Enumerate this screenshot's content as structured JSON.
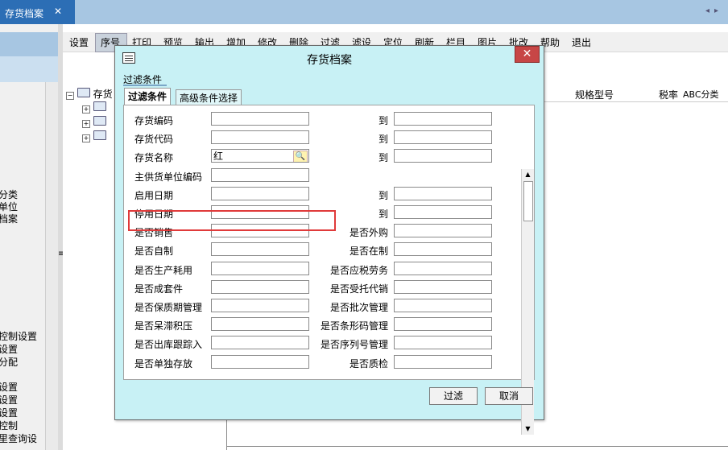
{
  "tab": {
    "title": "存货档案",
    "close": "✕",
    "nav": "◂▸"
  },
  "toolbar": [
    "设置",
    "序号",
    "打印",
    "预览",
    "输出",
    "增加",
    "修改",
    "删除",
    "过滤",
    "滤设",
    "定位",
    "刷新",
    "栏目",
    "图片",
    "批改",
    "帮助",
    "退出"
  ],
  "left_items": [
    "分类",
    "单位",
    "档案",
    "控制设置",
    "设置",
    "分配",
    "设置",
    "设置",
    "设置",
    "控制",
    "里查询设"
  ],
  "tree": {
    "root_label": "存货",
    "nodes": 3
  },
  "grid_headers": [
    "规格型号",
    "税率",
    "ABC分类"
  ],
  "dialog": {
    "title": "存货档案",
    "close_label": "✕",
    "group_label": "过滤条件",
    "tabs": [
      "过滤条件",
      "高级条件选择"
    ],
    "to_label": "到",
    "rows": [
      {
        "left": "存货编码",
        "right": "到",
        "value": ""
      },
      {
        "left": "存货代码",
        "right": "到",
        "value": ""
      },
      {
        "left": "存货名称",
        "right": "到",
        "value": "红"
      },
      {
        "left": "主供货单位编码",
        "right": "",
        "value": ""
      },
      {
        "left": "启用日期",
        "right": "到",
        "value": ""
      },
      {
        "left": "停用日期",
        "right": "到",
        "value": ""
      },
      {
        "left": "是否销售",
        "right": "是否外购",
        "value": ""
      },
      {
        "left": "是否自制",
        "right": "是否在制",
        "value": ""
      },
      {
        "left": "是否生产耗用",
        "right": "是否应税劳务",
        "value": ""
      },
      {
        "left": "是否成套件",
        "right": "是否受托代销",
        "value": ""
      },
      {
        "left": "是否保质期管理",
        "right": "是否批次管理",
        "value": ""
      },
      {
        "left": "是否呆滞积压",
        "right": "是否条形码管理",
        "value": ""
      },
      {
        "left": "是否出库跟踪入",
        "right": "是否序列号管理",
        "value": ""
      },
      {
        "left": "是否单独存放",
        "right": "是否质检",
        "value": ""
      }
    ],
    "buttons": {
      "filter": "过滤",
      "cancel": "取消"
    }
  },
  "colors": {
    "accent": "#2c6eb5",
    "dialog_bg": "#c8f1f5",
    "highlight": "#e03a3a"
  }
}
